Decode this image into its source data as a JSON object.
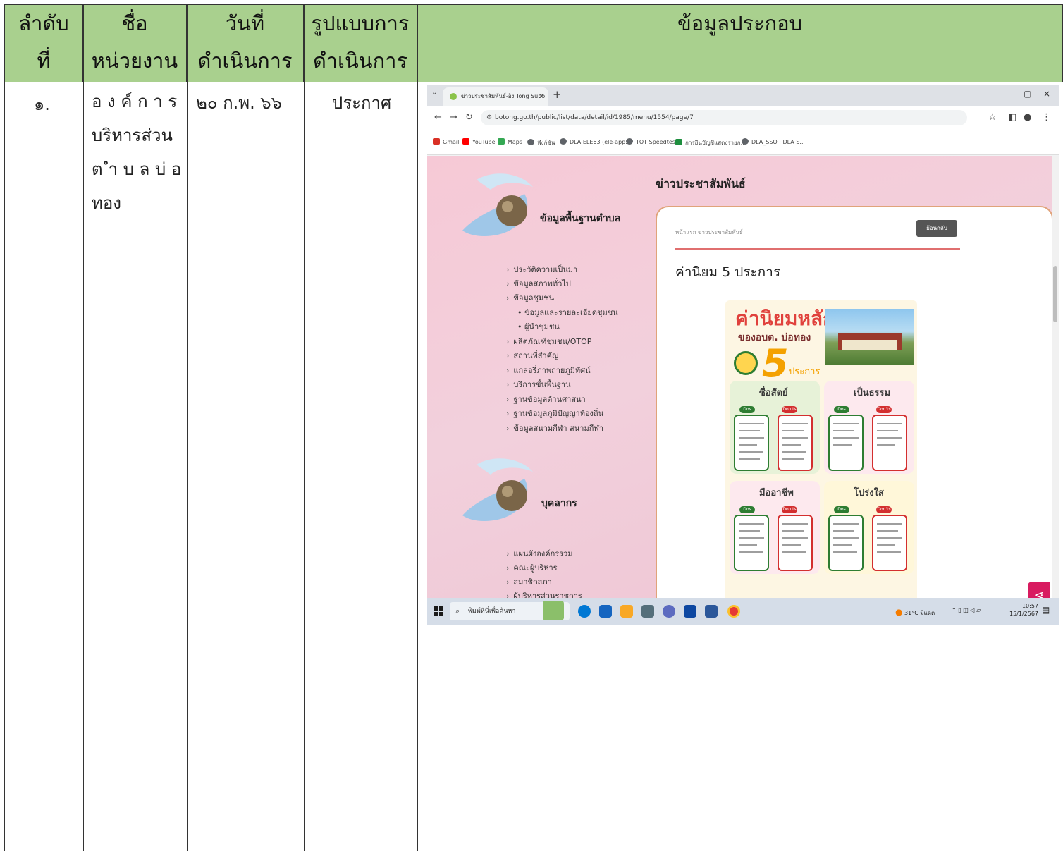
{
  "table": {
    "headers": [
      {
        "line1": "ลำดับ",
        "line2": "ที่"
      },
      {
        "line1": "ชื่อ",
        "line2": "หน่วยงาน"
      },
      {
        "line1": "วันที่",
        "line2": "ดำเนินการ"
      },
      {
        "line1": "รูปแบบการ",
        "line2": "ดำเนินการ"
      },
      {
        "line1": "ข้อมูลประกอบ",
        "line2": ""
      }
    ],
    "row": {
      "number": "๑.",
      "agency_lines": [
        "อ ง ค์ ก า ร",
        "บริหารส่วน",
        "ต ำ บ ล บ่ อ",
        "ทอง"
      ],
      "date": "๒๐ ก.พ. ๖๖",
      "format": "ประกาศ"
    }
  },
  "browser": {
    "tab_title": "ข่าวประชาสัมพันธ์-อิง Tong Subo",
    "tab_close": "×",
    "new_tab": "+",
    "url": "botong.go.th/public/list/data/detail/id/1985/menu/1554/page/7",
    "window_controls": [
      "–",
      "▢",
      "×"
    ],
    "bookmarks": [
      {
        "label": "Gmail",
        "color": "#d93025"
      },
      {
        "label": "YouTube",
        "color": "#ff0000"
      },
      {
        "label": "Maps",
        "color": "#34a853"
      },
      {
        "label": "ฟังก์ชัน",
        "color": "#5f6368"
      },
      {
        "label": "DLA ELE63 (ele-app..",
        "color": "#5f6368"
      },
      {
        "label": "TOT Speedtest",
        "color": "#5f6368"
      },
      {
        "label": "การยืนบัญชีแสดงรายก..",
        "color": "#1e8e3e"
      },
      {
        "label": "DLA_SSO : DLA S..",
        "color": "#5f6368"
      }
    ]
  },
  "site": {
    "section1_title": "ข้อมูลพื้นฐานตำบล",
    "section1_items": [
      "ประวัติความเป็นมา",
      "ข้อมูลสภาพทั่วไป",
      "ข้อมูลชุมชน",
      "• ข้อมูลและรายละเอียดชุมชน",
      "• ผู้นำชุมชน",
      "ผลิตภัณฑ์ชุมชน/OTOP",
      "สถานที่สำคัญ",
      "แกลอรี่ภาพถ่ายภูมิทัศน์",
      "บริการขั้นพื้นฐาน",
      "ฐานข้อมูลด้านศาสนา",
      "ฐานข้อมูลภูมิปัญญาท้องถิ่น",
      "ข้อมูลสนามกีฬา สนามกีฬา"
    ],
    "section2_title": "บุคลากร",
    "section2_items": [
      "แผนผังองค์กรรวม",
      "คณะผู้บริหาร",
      "สมาชิกสภา",
      "ผู้บริหารส่วนราชการ"
    ],
    "news_heading": "ข่าวประชาสัมพันธ์",
    "breadcrumb": "หน้าแรก  ข่าวประชาสัมพันธ์",
    "back_button": "ย้อนกลับ",
    "article_title": "ค่านิยม 5 ประการ",
    "poster": {
      "title": "ค่านิยมหลัก",
      "subtitle": "ของอบต. บ่อทอง",
      "five": "5",
      "five_label": "ประการ",
      "values": [
        "ซื่อสัตย์",
        "เป็นธรรม",
        "มืออาชีพ",
        "โปร่งใส"
      ],
      "dos": "Dos",
      "donts": "Don'ts"
    }
  },
  "taskbar": {
    "search_placeholder": "พิมพ์ที่นี่เพื่อค้นหา",
    "weather": "31°C มีแดด",
    "time": "10:57",
    "date": "15/1/2567"
  },
  "colors": {
    "header_green": "#a9d08e",
    "page_pink": "#f2d0dc",
    "accent_red": "#e0413c"
  }
}
